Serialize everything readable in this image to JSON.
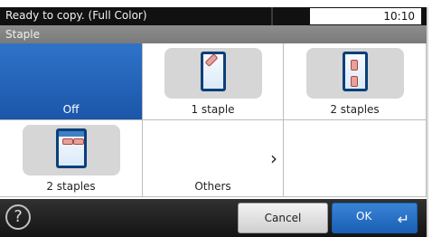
{
  "status": {
    "text": "Ready to copy. (Full Color)",
    "time": "10:10"
  },
  "title": "Staple",
  "options": [
    {
      "label": "Off",
      "selected": true
    },
    {
      "label": "1 staple",
      "selected": false
    },
    {
      "label": "2 staples",
      "selected": false
    },
    {
      "label": "2 staples",
      "selected": false
    },
    {
      "label": "Others",
      "selected": false
    }
  ],
  "buttons": {
    "help": "?",
    "cancel": "Cancel",
    "ok": "OK"
  },
  "colors": {
    "selected": "#1f5fb5",
    "ok": "#2a72c8"
  },
  "icons": {
    "help": "question-circle-icon",
    "chevron": "chevron-right-icon",
    "enter": "enter-return-icon"
  }
}
